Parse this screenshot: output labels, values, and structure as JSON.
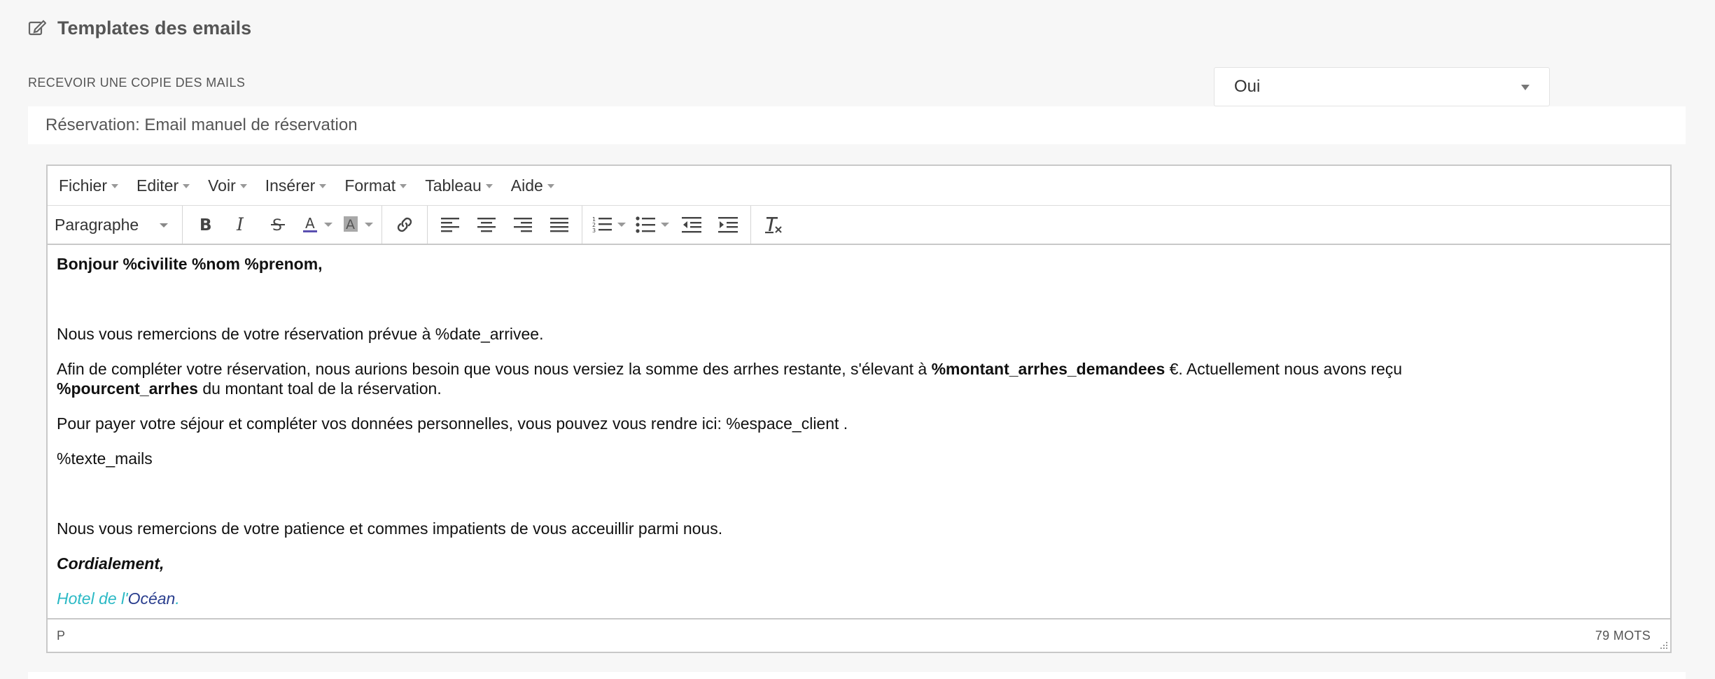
{
  "header": {
    "title": "Templates des emails",
    "icon": "edit-icon"
  },
  "setting": {
    "label": "RECEVOIR UNE COPIE DES MAILS",
    "value": "Oui"
  },
  "template": {
    "title": "Réservation: Email manuel de réservation",
    "menubar": [
      "Fichier",
      "Editer",
      "Voir",
      "Insérer",
      "Format",
      "Tableau",
      "Aide"
    ],
    "toolbar": {
      "format_value": "Paragraphe"
    },
    "body": {
      "greeting": "Bonjour %civilite %nom %prenom,",
      "p1": "Nous vous remercions de votre réservation prévue à %date_arrivee.",
      "p2_a": "Afin de compléter votre réservation, nous aurions besoin que vous nous versiez la somme des arrhes restante, s'élevant à ",
      "p2_b": "%montant_arrhes_demandees",
      "p2_c": " €. Actuellement nous avons reçu ",
      "p2_d": "%pourcent_arrhes",
      "p2_e": " du montant toal de la réservation.",
      "p3": "Pour payer votre séjour et compléter vos données personnelles, vous pouvez vous rendre ici: %espace_client .",
      "p4": "%texte_mails",
      "p5": "Nous vous remercions de votre patience et commes impatients de vous acceuillir parmi nous.",
      "closing": "Cordialement,",
      "signature_a": "Hotel de l'",
      "signature_b": "Océan",
      "signature_c": "."
    },
    "status": {
      "path": "P",
      "word_count": "79 MOTS"
    }
  },
  "colors": {
    "signature_teal": "#2bb9c5",
    "signature_navy": "#2a3e8e"
  }
}
